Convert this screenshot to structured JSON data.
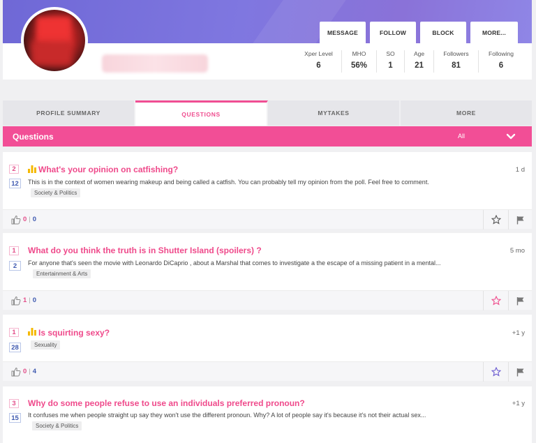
{
  "profile": {
    "actions": [
      {
        "label": "MESSAGE"
      },
      {
        "label": "FOLLOW"
      },
      {
        "label": "BLOCK"
      },
      {
        "label": "MORE..."
      }
    ],
    "stats": [
      {
        "label": "Xper Level",
        "value": "6"
      },
      {
        "label": "MHO",
        "value": "56%"
      },
      {
        "label": "SO",
        "value": "1"
      },
      {
        "label": "Age",
        "value": "21"
      },
      {
        "label": "Followers",
        "value": "81"
      },
      {
        "label": "Following",
        "value": "6"
      }
    ]
  },
  "tabs": [
    {
      "label": "PROFILE SUMMARY",
      "active": false
    },
    {
      "label": "QUESTIONS",
      "active": true
    },
    {
      "label": "MYTAKES",
      "active": false
    },
    {
      "label": "MORE",
      "active": false
    }
  ],
  "questions_bar": {
    "title": "Questions",
    "filter": "All"
  },
  "questions": [
    {
      "votes": "2",
      "answers": "12",
      "poll": true,
      "title": "What's your opinion on catfishing?",
      "time": "1 d",
      "desc": "This is in the context of women wearing makeup and being called a catfish. You can probably tell my opinion from the poll. Feel free to comment.",
      "tag": "Society & Politics",
      "up": "0",
      "down": "0",
      "star_color": "#555555"
    },
    {
      "votes": "1",
      "answers": "2",
      "poll": false,
      "title": "What do you think the truth is in Shutter Island (spoilers) ?",
      "time": "5 mo",
      "desc": "For anyone that's seen the movie with Leonardo DiCaprio , about a Marshal that comes to investigate a the escape of a missing patient in a mental...",
      "tag": "Entertainment & Arts",
      "up": "1",
      "down": "0",
      "star_color": "#ef4a8b"
    },
    {
      "votes": "1",
      "answers": "28",
      "poll": true,
      "title": "Is squirting sexy?",
      "time": "+1 y",
      "desc": "",
      "tag": "Sexuality",
      "up": "0",
      "down": "4",
      "star_color": "#6a5ad0"
    },
    {
      "votes": "3",
      "answers": "15",
      "poll": false,
      "title": "Why do some people refuse to use an individuals preferred pronoun?",
      "time": "+1 y",
      "desc": "It confuses me when people straight up say they won't use the different pronoun. Why? A lot of people say it's because it's not their actual sex...",
      "tag": "Society & Politics",
      "up": "",
      "down": "",
      "star_color": "#555555"
    }
  ],
  "colors": {
    "accent": "#f24e96",
    "header": "#7f77e0",
    "answers": "#3e59b0"
  }
}
